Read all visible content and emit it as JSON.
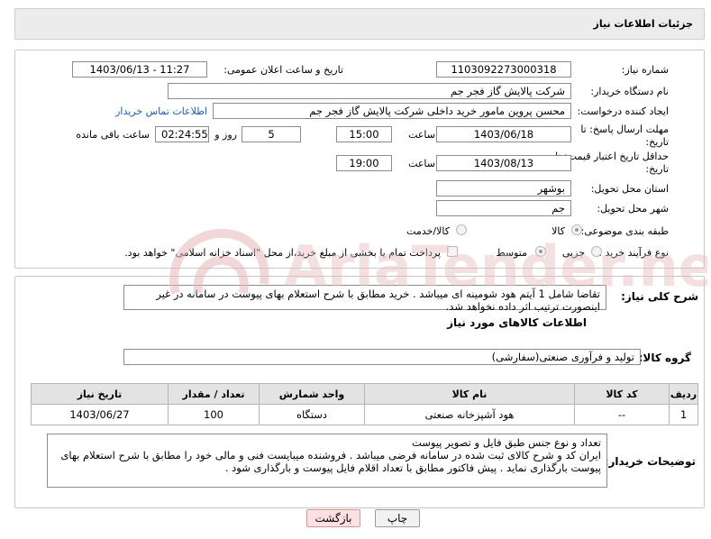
{
  "page": {
    "title": "جزئیات اطلاعات نیاز"
  },
  "labels": {
    "need_number": "شماره نیاز:",
    "announce_datetime": "تاریخ و ساعت اعلان عمومی:",
    "buyer_org": "نام دستگاه خریدار:",
    "requester": "ایجاد کننده درخواست:",
    "contact_link": "اطلاعات تماس خریدار",
    "reply_deadline": "مهلت ارسال پاسخ: تا تاریخ:",
    "time": "ساعت",
    "day_and": "روز و",
    "remaining": "ساعت باقی مانده",
    "price_validity": "حداقل تاریخ اعتبار قیمت: تا تاریخ:",
    "province": "استان محل تحویل:",
    "city": "شهر محل تحویل:",
    "category": "طبقه بندی موضوعی:",
    "process_type": "نوع فرآیند خرید :",
    "description": "شرح کلی نیاز:",
    "goods_info": "اطلاعات کالاهای مورد نیاز",
    "goods_group": "گروه کالا:",
    "buyer_notes": "توضیحات خریدار:"
  },
  "values": {
    "need_number": "1103092273000318",
    "announce_datetime": "1403/06/13 - 11:27",
    "buyer_org": "شرکت پالایش گاز فجر جم",
    "requester": "محسن پروین مامور خرید داخلی شرکت پالایش گاز فجر جم",
    "reply_date": "1403/06/18",
    "reply_time": "15:00",
    "days": "5",
    "remaining_time": "02:24:55",
    "validity_date": "1403/08/13",
    "validity_time": "19:00",
    "province": "بوشهر",
    "city": "جم",
    "description": "تقاضا شامل 1 آیتم هود شومینه ای میباشد . خرید مطابق با شرح استعلام بهای پیوست در سامانه در غیر اینصورت ترتیب اثر داده نخواهد شد.",
    "goods_group": "تولید و فرآوری صنعتی(سفارشی)",
    "buyer_notes": "تعداد و نوع جنس طبق فایل و تصویر پیوست\nایران کد و شرح کالای ثبت شده در سامانه فرضی میباشد . فروشنده میبایست فنی و مالی خود را مطابق با شرح استعلام بهای پیوست بارگذاری نماید . پیش فاکتور مطابق با تعداد اقلام فایل پیوست و بارگذاری شود ."
  },
  "category_options": {
    "goods": "کالا",
    "goods_service": "کالا/خدمت"
  },
  "process_options": {
    "minor": "جزیی",
    "medium": "متوسط",
    "treasury_note": "پرداخت تمام یا بخشی از مبلغ خرید،از محل \"اسناد خزانه اسلامی\" خواهد بود."
  },
  "table": {
    "headers": [
      "ردیف",
      "کد کالا",
      "نام کالا",
      "واحد شمارش",
      "تعداد / مقدار",
      "تاریخ نیاز"
    ],
    "rows": [
      [
        "1",
        "--",
        "هود آشپزخانه صنعتی",
        "دستگاه",
        "100",
        "1403/06/27"
      ]
    ]
  },
  "buttons": {
    "print": "چاپ",
    "back": "بازگشت"
  },
  "colors": {
    "link": "#1a5fb4",
    "header_bg": "#e3e3e3",
    "back_button_bg": "#fde0e0"
  },
  "watermark_text": "AriaTender.net"
}
